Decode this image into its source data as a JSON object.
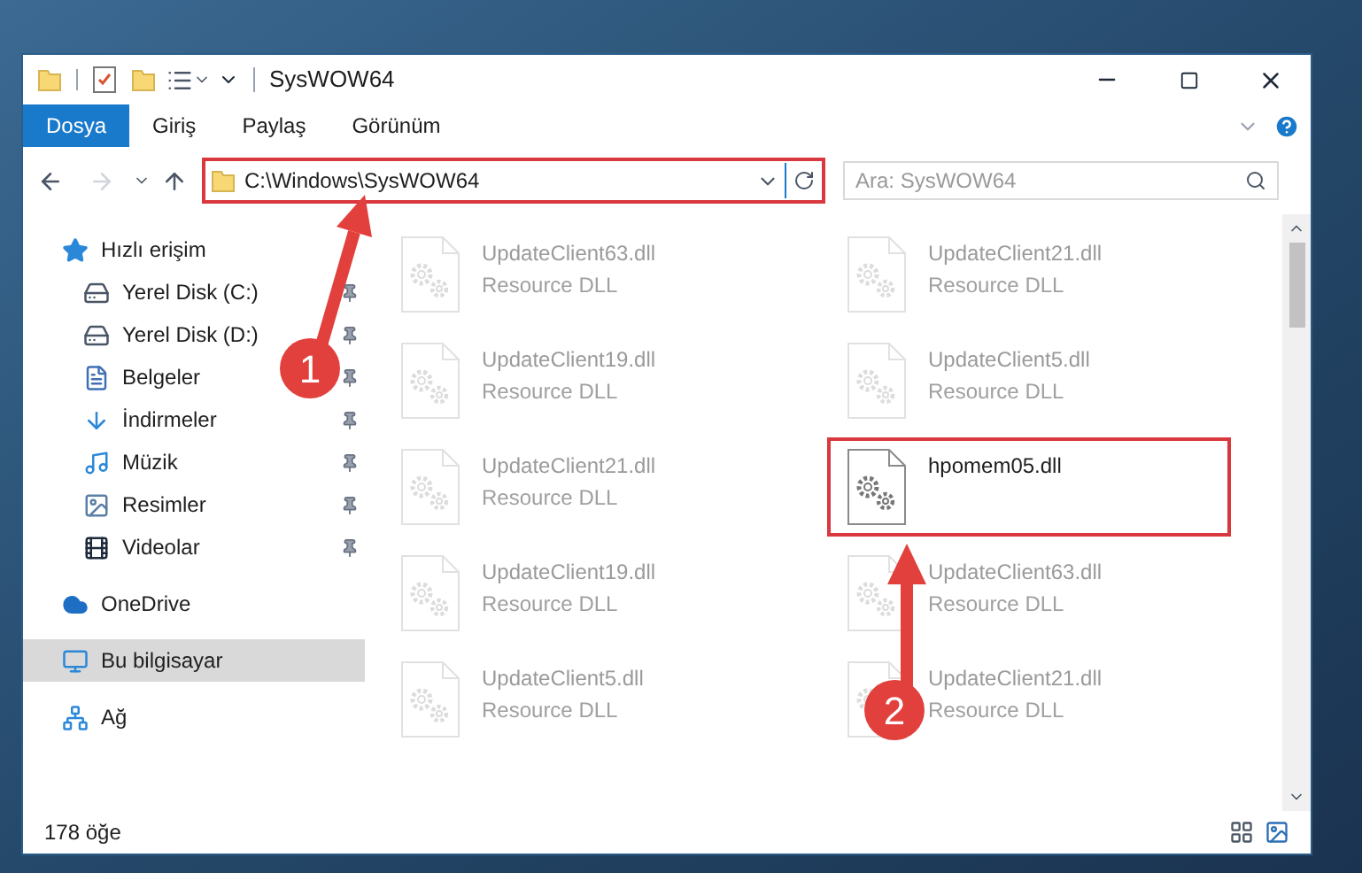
{
  "window": {
    "title": "SysWOW64"
  },
  "ribbon_tabs": [
    {
      "label": "Dosya",
      "selected": true
    },
    {
      "label": "Giriş",
      "selected": false
    },
    {
      "label": "Paylaş",
      "selected": false
    },
    {
      "label": "Görünüm",
      "selected": false
    }
  ],
  "address": {
    "value": "C:\\Windows\\SysWOW64"
  },
  "search": {
    "placeholder": "Ara: SysWOW64"
  },
  "sidebar": [
    {
      "label": "Hızlı erişim",
      "kind": "star",
      "selected": false,
      "children": [
        {
          "label": "Yerel Disk (C:)",
          "kind": "drive",
          "pinned": true,
          "selected": false
        },
        {
          "label": "Yerel Disk (D:)",
          "kind": "drive",
          "pinned": true,
          "selected": false
        },
        {
          "label": "Belgeler",
          "kind": "document",
          "pinned": true,
          "selected": false
        },
        {
          "label": "İndirmeler",
          "kind": "download",
          "pinned": true,
          "selected": false
        },
        {
          "label": "Müzik",
          "kind": "music",
          "pinned": true,
          "selected": false
        },
        {
          "label": "Resimler",
          "kind": "picture",
          "pinned": true,
          "selected": false
        },
        {
          "label": "Videolar",
          "kind": "video",
          "pinned": true,
          "selected": false
        }
      ]
    },
    {
      "label": "OneDrive",
      "kind": "cloud",
      "selected": false
    },
    {
      "label": "Bu bilgisayar",
      "kind": "computer",
      "selected": true
    },
    {
      "label": "Ağ",
      "kind": "network",
      "selected": false
    }
  ],
  "files": [
    {
      "name": "UpdateClient63.dll",
      "type": "Resource DLL",
      "dimmed": true
    },
    {
      "name": "UpdateClient21.dll",
      "type": "Resource DLL",
      "dimmed": true
    },
    {
      "name": "UpdateClient19.dll",
      "type": "Resource DLL",
      "dimmed": true
    },
    {
      "name": "UpdateClient5.dll",
      "type": "Resource DLL",
      "dimmed": true
    },
    {
      "name": "UpdateClient21.dll",
      "type": "Resource DLL",
      "dimmed": true
    },
    {
      "name": "hpomem05.dll",
      "dimmed": false
    },
    {
      "name": "UpdateClient19.dll",
      "type": "Resource DLL",
      "dimmed": true
    },
    {
      "name": "UpdateClient63.dll",
      "type": "Resource DLL",
      "dimmed": true
    },
    {
      "name": "UpdateClient5.dll",
      "type": "Resource DLL",
      "dimmed": true
    },
    {
      "name": "UpdateClient21.dll",
      "type": "Resource DLL",
      "dimmed": true
    }
  ],
  "status_bar": {
    "count": "178 öğe"
  },
  "annotations": [
    {
      "number": "1"
    },
    {
      "number": "2"
    }
  ]
}
